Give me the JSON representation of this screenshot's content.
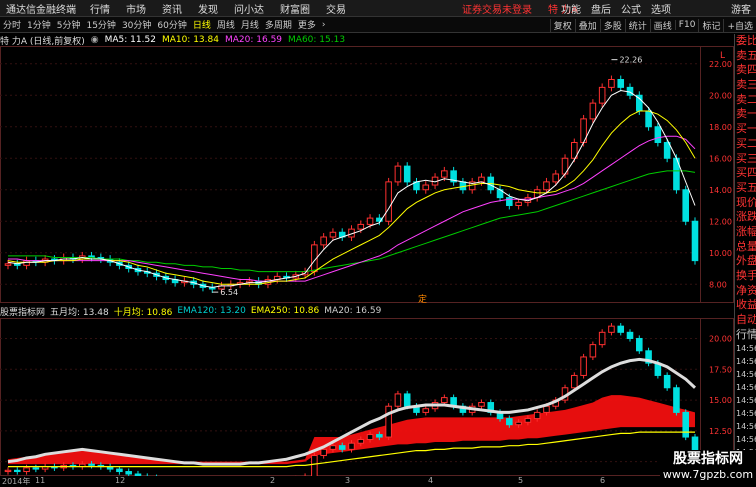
{
  "menubar": {
    "app_title": "通达信金融终端",
    "items": [
      "行情",
      "市场",
      "资讯",
      "发现",
      "问小达",
      "财富圈",
      "交易"
    ],
    "notice": "证券交易未登录",
    "stock_name": "特 力A",
    "right_items": [
      "功能",
      "盘后",
      "公式",
      "选项"
    ],
    "guest": "游客"
  },
  "toolbar": {
    "periods": [
      "分时",
      "1分钟",
      "5分钟",
      "15分钟",
      "30分钟",
      "60分钟",
      "日线",
      "周线",
      "月线",
      "多周期",
      "更多"
    ],
    "active_period": "日线",
    "right_items": [
      "复权",
      "叠加",
      "多股",
      "统计",
      "画线",
      "F10",
      "标记",
      "+自选"
    ]
  },
  "main_legend": {
    "title": "特 力A (日线,前复权)",
    "ma5": "MA5: 11.52",
    "ma10": "MA10: 13.84",
    "ma20": "MA20: 16.59",
    "ma60": "MA60: 15.13"
  },
  "sub_legend": {
    "title": "股票指标网",
    "items": [
      "五月均: 13.48",
      "十月均: 10.86",
      "EMA120: 13.20",
      "EMA250: 10.86",
      "MA20: 16.59"
    ]
  },
  "main_yaxis": [
    "22.00",
    "20.00",
    "18.00",
    "16.00",
    "14.00",
    "12.00",
    "10.00",
    "8.00"
  ],
  "sub_yaxis": [
    "20.00",
    "17.50",
    "15.00",
    "12.50",
    "10.00"
  ],
  "annotations": {
    "high": "22.26",
    "low": "6.54",
    "marker": "定"
  },
  "x_labels": [
    "2014年",
    "11",
    "12",
    "2",
    "3",
    "4",
    "5",
    "6"
  ],
  "right_panel": {
    "top": [
      "委比",
      "卖五",
      "卖四",
      "卖三",
      "卖二",
      "卖一",
      "买一",
      "买二",
      "买三",
      "买四",
      "买五",
      "现价",
      "涨跌",
      "涨幅",
      "总量",
      "外盘",
      "换手",
      "净资",
      "收益"
    ],
    "bottom_label": "自动",
    "bottom_title": "行情",
    "times": [
      "14:56",
      "14:56",
      "14:56",
      "14:56",
      "14:56",
      "14:56",
      "14:56",
      "14:56",
      "14:56"
    ]
  },
  "side_tag": "L",
  "watermark": {
    "line1": "股票指标网",
    "line2": "www.7gpzb.com"
  },
  "colors": {
    "up": "#ff3030",
    "down": "#00e0e0",
    "ma5": "#ffffff",
    "ma10": "#ffff00",
    "ma20": "#ff40ff",
    "ma60": "#00cc00",
    "menu_notice": "#ff3333"
  },
  "chart_data": {
    "type": "candlestick",
    "main": {
      "ylim": [
        7,
        23
      ],
      "close": [
        9.3,
        9.2,
        9.5,
        9.4,
        9.6,
        9.5,
        9.7,
        9.6,
        9.8,
        9.7,
        9.6,
        9.4,
        9.2,
        9.0,
        8.8,
        8.7,
        8.5,
        8.3,
        8.1,
        8.2,
        8.0,
        7.8,
        7.7,
        7.9,
        8.0,
        8.1,
        8.2,
        8.0,
        8.3,
        8.5,
        8.4,
        8.6,
        8.8,
        10.5,
        11.0,
        11.3,
        11.0,
        11.5,
        11.8,
        12.2,
        12.0,
        14.5,
        15.5,
        14.5,
        14.0,
        14.3,
        14.8,
        15.2,
        14.5,
        14.0,
        14.5,
        14.8,
        14.0,
        13.5,
        13.0,
        13.2,
        13.5,
        14.0,
        14.5,
        15.0,
        16.0,
        17.0,
        18.5,
        19.5,
        20.5,
        21.0,
        20.5,
        20.0,
        19.0,
        18.0,
        17.0,
        16.0,
        14.0,
        12.0,
        9.5
      ],
      "ma5": [
        9.4,
        9.3,
        9.4,
        9.4,
        9.5,
        9.5,
        9.6,
        9.6,
        9.7,
        9.6,
        9.6,
        9.5,
        9.3,
        9.1,
        8.9,
        8.8,
        8.6,
        8.4,
        8.3,
        8.2,
        8.1,
        7.9,
        7.8,
        7.9,
        7.9,
        8.0,
        8.1,
        8.1,
        8.2,
        8.3,
        8.4,
        8.5,
        8.7,
        9.5,
        10.2,
        10.8,
        11.0,
        11.2,
        11.4,
        11.7,
        11.9,
        12.8,
        13.8,
        14.2,
        14.5,
        14.6,
        14.5,
        14.7,
        14.6,
        14.5,
        14.4,
        14.5,
        14.3,
        14.0,
        13.6,
        13.4,
        13.3,
        13.5,
        13.8,
        14.3,
        15.0,
        15.9,
        17.0,
        18.2,
        19.2,
        20.0,
        20.3,
        20.2,
        19.8,
        19.2,
        18.3,
        17.2,
        16.0,
        14.5,
        13.0
      ],
      "ma10": [
        9.5,
        9.4,
        9.4,
        9.4,
        9.4,
        9.5,
        9.5,
        9.5,
        9.6,
        9.6,
        9.6,
        9.5,
        9.5,
        9.4,
        9.2,
        9.1,
        8.9,
        8.7,
        8.6,
        8.5,
        8.4,
        8.2,
        8.1,
        8.0,
        8.0,
        8.0,
        8.0,
        8.0,
        8.1,
        8.2,
        8.2,
        8.3,
        8.4,
        8.8,
        9.2,
        9.6,
        9.9,
        10.2,
        10.5,
        10.8,
        11.1,
        11.6,
        12.2,
        12.8,
        13.2,
        13.5,
        13.8,
        14.0,
        14.1,
        14.2,
        14.3,
        14.4,
        14.4,
        14.3,
        14.2,
        14.0,
        13.9,
        13.8,
        13.8,
        13.9,
        14.2,
        14.6,
        15.2,
        15.9,
        16.8,
        17.6,
        18.2,
        18.7,
        19.0,
        19.0,
        18.8,
        18.4,
        17.8,
        17.0,
        16.0
      ],
      "ma20": [
        9.6,
        9.6,
        9.5,
        9.5,
        9.5,
        9.5,
        9.5,
        9.5,
        9.5,
        9.5,
        9.5,
        9.5,
        9.5,
        9.5,
        9.4,
        9.3,
        9.2,
        9.1,
        9.0,
        8.9,
        8.8,
        8.7,
        8.6,
        8.5,
        8.4,
        8.3,
        8.3,
        8.2,
        8.2,
        8.2,
        8.2,
        8.2,
        8.2,
        8.4,
        8.6,
        8.8,
        9.0,
        9.2,
        9.4,
        9.6,
        9.8,
        10.1,
        10.5,
        10.8,
        11.1,
        11.4,
        11.7,
        12.0,
        12.3,
        12.6,
        12.8,
        13.0,
        13.2,
        13.3,
        13.4,
        13.4,
        13.4,
        13.5,
        13.6,
        13.7,
        13.9,
        14.1,
        14.4,
        14.8,
        15.2,
        15.6,
        16.0,
        16.4,
        16.8,
        17.1,
        17.3,
        17.4,
        17.4,
        17.2,
        16.6
      ],
      "ma60": [
        9.8,
        9.8,
        9.8,
        9.8,
        9.8,
        9.7,
        9.7,
        9.7,
        9.7,
        9.7,
        9.6,
        9.6,
        9.6,
        9.5,
        9.5,
        9.4,
        9.4,
        9.3,
        9.3,
        9.2,
        9.2,
        9.1,
        9.1,
        9.0,
        9.0,
        8.9,
        8.9,
        8.8,
        8.8,
        8.8,
        8.8,
        8.8,
        8.8,
        8.9,
        9.0,
        9.1,
        9.2,
        9.3,
        9.4,
        9.5,
        9.6,
        9.8,
        10.0,
        10.2,
        10.4,
        10.6,
        10.8,
        11.0,
        11.2,
        11.4,
        11.6,
        11.8,
        12.0,
        12.2,
        12.3,
        12.4,
        12.5,
        12.6,
        12.8,
        13.0,
        13.2,
        13.4,
        13.6,
        13.8,
        14.0,
        14.2,
        14.4,
        14.6,
        14.8,
        15.0,
        15.1,
        15.2,
        15.2,
        15.2,
        15.1
      ]
    },
    "sub": {
      "ylim": [
        9,
        21.5
      ],
      "white_line": [
        10.0,
        10.1,
        10.3,
        10.4,
        10.6,
        10.7,
        10.8,
        10.9,
        11.0,
        10.9,
        10.8,
        10.7,
        10.6,
        10.5,
        10.4,
        10.3,
        10.2,
        10.1,
        10.0,
        9.9,
        9.9,
        9.8,
        9.8,
        9.8,
        9.8,
        9.8,
        9.9,
        9.9,
        10.0,
        10.1,
        10.2,
        10.4,
        10.6,
        10.9,
        11.2,
        11.6,
        12.0,
        12.4,
        12.8,
        13.2,
        13.5,
        13.9,
        14.2,
        14.4,
        14.5,
        14.6,
        14.6,
        14.6,
        14.5,
        14.4,
        14.3,
        14.2,
        14.1,
        14.0,
        14.0,
        14.1,
        14.2,
        14.4,
        14.6,
        14.9,
        15.3,
        15.8,
        16.3,
        16.8,
        17.3,
        17.7,
        18.0,
        18.2,
        18.3,
        18.2,
        18.0,
        17.7,
        17.2,
        16.7,
        16.0
      ],
      "yellow_line": [
        9.6,
        9.6,
        9.6,
        9.6,
        9.6,
        9.6,
        9.6,
        9.6,
        9.6,
        9.6,
        9.6,
        9.6,
        9.6,
        9.6,
        9.6,
        9.6,
        9.6,
        9.6,
        9.6,
        9.6,
        9.6,
        9.6,
        9.6,
        9.6,
        9.6,
        9.6,
        9.6,
        9.6,
        9.6,
        9.6,
        9.6,
        9.7,
        9.7,
        9.8,
        9.9,
        10.0,
        10.1,
        10.2,
        10.3,
        10.4,
        10.5,
        10.6,
        10.7,
        10.8,
        10.9,
        10.9,
        11.0,
        11.0,
        11.1,
        11.1,
        11.1,
        11.2,
        11.2,
        11.2,
        11.3,
        11.3,
        11.4,
        11.4,
        11.5,
        11.6,
        11.7,
        11.8,
        11.9,
        12.0,
        12.1,
        12.2,
        12.3,
        12.3,
        12.4,
        12.4,
        12.4,
        12.4,
        12.4,
        12.4,
        12.4
      ],
      "band_top": [
        10.2,
        10.3,
        10.4,
        10.5,
        10.6,
        10.7,
        10.8,
        10.9,
        11.0,
        10.9,
        10.8,
        10.7,
        10.6,
        10.5,
        10.4,
        10.3,
        10.2,
        10.1,
        10.0,
        10.0,
        10.0,
        10.0,
        10.0,
        10.0,
        10.0,
        10.0,
        10.0,
        10.0,
        10.0,
        10.0,
        10.0,
        10.1,
        10.2,
        12.0,
        12.0,
        12.0,
        12.0,
        12.2,
        12.4,
        12.6,
        12.8,
        13.0,
        13.2,
        13.4,
        13.5,
        13.6,
        13.6,
        13.6,
        13.6,
        13.6,
        13.6,
        13.6,
        13.6,
        13.6,
        13.6,
        13.7,
        13.8,
        13.9,
        14.0,
        14.1,
        14.2,
        14.4,
        14.6,
        14.8,
        15.2,
        15.4,
        15.4,
        15.3,
        15.2,
        15.0,
        14.8,
        14.6,
        14.4,
        14.2,
        14.0
      ],
      "band_bottom": [
        9.8,
        9.8,
        9.8,
        9.8,
        9.8,
        9.8,
        9.8,
        9.8,
        9.8,
        9.8,
        9.8,
        9.8,
        9.8,
        9.8,
        9.8,
        9.8,
        9.8,
        9.8,
        9.8,
        9.8,
        9.8,
        9.8,
        9.8,
        9.8,
        9.8,
        9.8,
        9.8,
        9.8,
        9.8,
        9.8,
        9.8,
        9.9,
        10.0,
        10.5,
        10.6,
        10.7,
        10.8,
        10.9,
        11.0,
        11.1,
        11.2,
        11.3,
        11.4,
        11.4,
        11.5,
        11.5,
        11.6,
        11.6,
        11.6,
        11.7,
        11.7,
        11.7,
        11.7,
        11.7,
        11.8,
        11.8,
        11.9,
        11.9,
        12.0,
        12.1,
        12.2,
        12.3,
        12.4,
        12.5,
        12.6,
        12.7,
        12.8,
        12.8,
        12.8,
        12.8,
        12.8,
        12.8,
        12.8,
        12.8,
        12.8
      ]
    }
  }
}
